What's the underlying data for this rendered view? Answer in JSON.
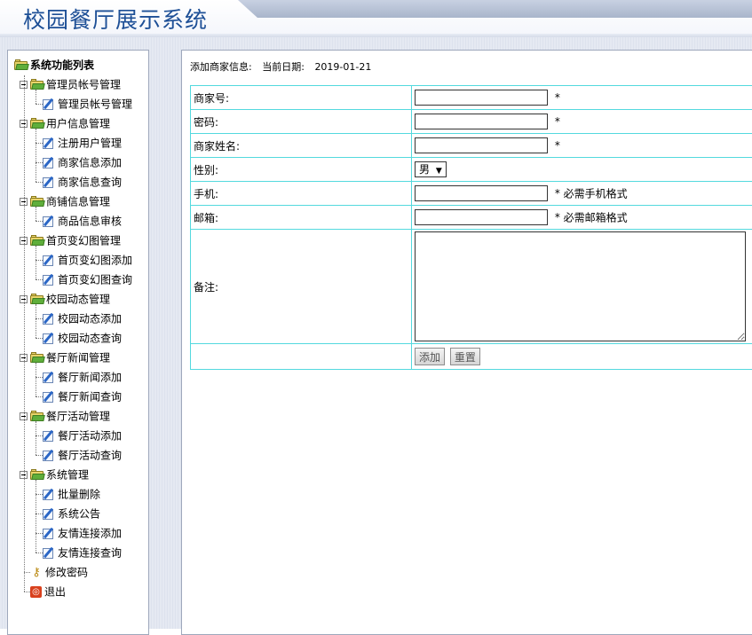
{
  "header": {
    "title": "校园餐厅展示系统"
  },
  "sidebar": {
    "root_label": "系统功能列表",
    "groups": [
      {
        "label": "管理员帐号管理",
        "items": [
          "管理员帐号管理"
        ]
      },
      {
        "label": "用户信息管理",
        "items": [
          "注册用户管理",
          "商家信息添加",
          "商家信息查询"
        ]
      },
      {
        "label": "商铺信息管理",
        "items": [
          "商品信息审核"
        ]
      },
      {
        "label": "首页变幻图管理",
        "items": [
          "首页变幻图添加",
          "首页变幻图查询"
        ]
      },
      {
        "label": "校园动态管理",
        "items": [
          "校园动态添加",
          "校园动态查询"
        ]
      },
      {
        "label": "餐厅新闻管理",
        "items": [
          "餐厅新闻添加",
          "餐厅新闻查询"
        ]
      },
      {
        "label": "餐厅活动管理",
        "items": [
          "餐厅活动添加",
          "餐厅活动查询"
        ]
      },
      {
        "label": "系统管理",
        "items": [
          "批量删除",
          "系统公告",
          "友情连接添加",
          "友情连接查询"
        ]
      }
    ],
    "change_password": "修改密码",
    "logout": "退出"
  },
  "form": {
    "heading": "添加商家信息:",
    "date_label": "当前日期:",
    "date_value": "2019-01-21",
    "fields": {
      "merchant_no": {
        "label": "商家号:",
        "value": "",
        "required": "*"
      },
      "password": {
        "label": "密码:",
        "value": "",
        "required": "*"
      },
      "merchant_name": {
        "label": "商家姓名:",
        "value": "",
        "required": "*"
      },
      "gender": {
        "label": "性别:",
        "selected": "男"
      },
      "phone": {
        "label": "手机:",
        "value": "",
        "required": "*",
        "hint": "必需手机格式"
      },
      "email": {
        "label": "邮箱:",
        "value": "",
        "required": "*",
        "hint": "必需邮箱格式"
      },
      "notes": {
        "label": "备注:",
        "value": ""
      }
    },
    "buttons": {
      "add": "添加",
      "reset": "重置"
    }
  }
}
